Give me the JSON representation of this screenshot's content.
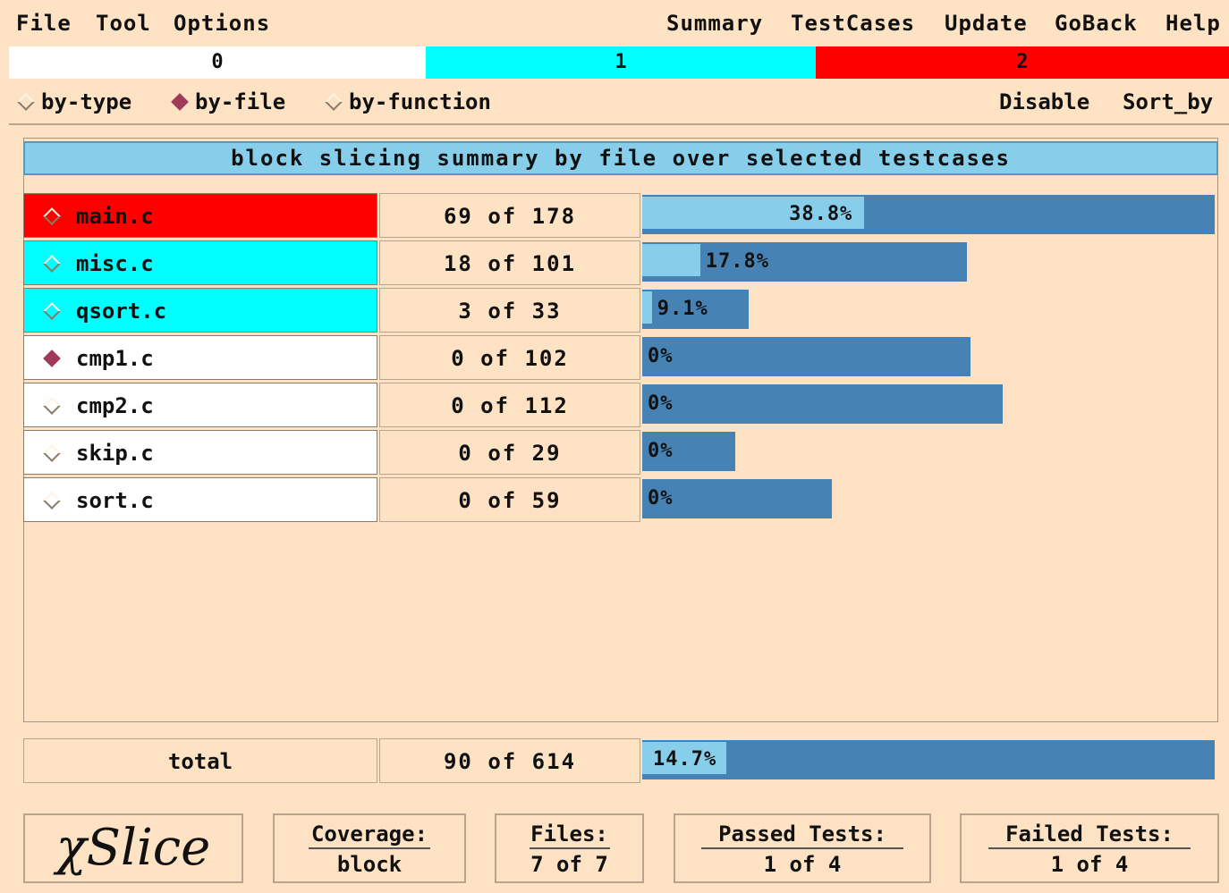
{
  "menubar": {
    "left": [
      "File",
      "Tool",
      "Options"
    ],
    "right": [
      "Summary",
      "TestCases",
      "Update",
      "GoBack",
      "Help"
    ]
  },
  "scale": [
    {
      "label": "0",
      "color": "#ffffff"
    },
    {
      "label": "1",
      "color": "#00ffff"
    },
    {
      "label": "2",
      "color": "#ff0000"
    }
  ],
  "view_options": {
    "radios": [
      {
        "label": "by-type",
        "selected": false
      },
      {
        "label": "by-file",
        "selected": true
      },
      {
        "label": "by-function",
        "selected": false
      }
    ],
    "disable": "Disable",
    "sort_by": "Sort_by"
  },
  "summary": {
    "title": "block slicing summary by file over selected testcases",
    "rows": [
      {
        "name": "main.c",
        "count": "69 of 178",
        "percent": "38.8%",
        "covered": 69,
        "total": 178,
        "color": "#ff0000",
        "selected": false
      },
      {
        "name": "misc.c",
        "count": "18 of 101",
        "percent": "17.8%",
        "covered": 18,
        "total": 101,
        "color": "#00ffff",
        "selected": false
      },
      {
        "name": "qsort.c",
        "count": "3 of 33",
        "percent": "9.1%",
        "covered": 3,
        "total": 33,
        "color": "#00ffff",
        "selected": false
      },
      {
        "name": "cmp1.c",
        "count": "0 of 102",
        "percent": "0%",
        "covered": 0,
        "total": 102,
        "color": "#ffffff",
        "selected": true
      },
      {
        "name": "cmp2.c",
        "count": "0 of 112",
        "percent": "0%",
        "covered": 0,
        "total": 112,
        "color": "#ffffff",
        "selected": false
      },
      {
        "name": "skip.c",
        "count": "0 of 29",
        "percent": "0%",
        "covered": 0,
        "total": 29,
        "color": "#ffffff",
        "selected": false
      },
      {
        "name": "sort.c",
        "count": "0 of 59",
        "percent": "0%",
        "covered": 0,
        "total": 59,
        "color": "#ffffff",
        "selected": false
      }
    ],
    "total": {
      "name": "total",
      "count": "90 of 614",
      "percent": "14.7%",
      "covered": 90,
      "total": 614
    }
  },
  "footer": {
    "logo": "χSlice",
    "coverage": {
      "label": "Coverage:",
      "value": "block"
    },
    "files": {
      "label": "Files:",
      "value": "7 of 7"
    },
    "passed": {
      "label": "Passed Tests:",
      "value": "1 of 4"
    },
    "failed": {
      "label": "Failed Tests:",
      "value": "1 of 4"
    }
  },
  "colors": {
    "background": "#fde2c4",
    "bar": "#4682b4",
    "bar_fill": "#87ceeb",
    "header": "#87ceeb"
  }
}
